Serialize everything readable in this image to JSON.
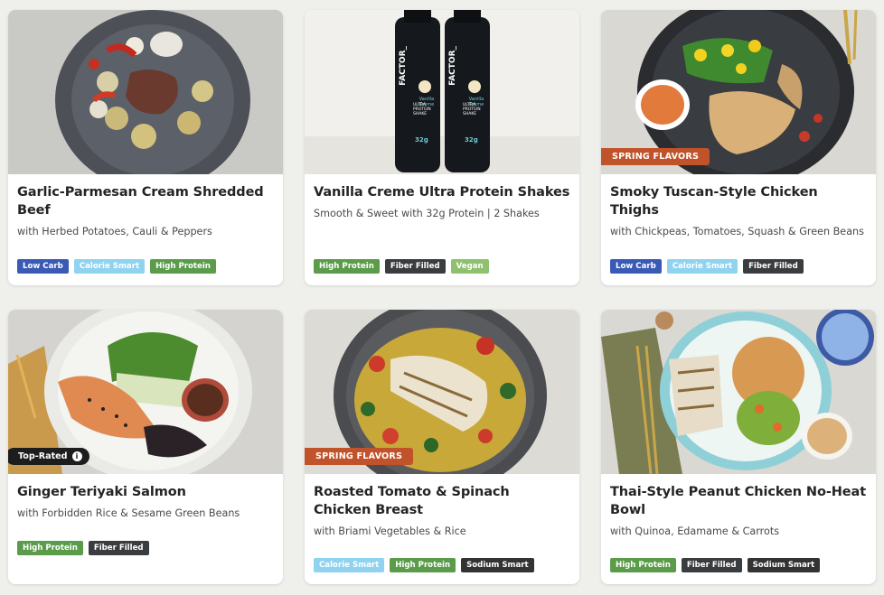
{
  "colors": {
    "background": "#efefec",
    "promo_badge": "#c0532a",
    "tag_low_carb": "#3a5ab8",
    "tag_calorie_smart": "#8fd3f0",
    "tag_high_protein": "#5a9c4a",
    "tag_fiber_filled": "#3a3d40",
    "tag_vegan": "#8fc06e",
    "tag_sodium_smart": "#333333"
  },
  "meals": [
    {
      "title": "Garlic-Parmesan Cream Shredded Beef",
      "subtitle": "with Herbed Potatoes, Cauli & Peppers",
      "badge": "",
      "tags": [
        "Low Carb",
        "Calorie Smart",
        "High Protein"
      ]
    },
    {
      "title": "Vanilla Creme Ultra Protein Shakes",
      "subtitle": "Smooth & Sweet with 32g Protein | 2 Shakes",
      "badge": "",
      "bottle_text": [
        "FACTOR_",
        "Vanilla Crème",
        "ULTRA PROTEIN SHAKE",
        "32g"
      ],
      "tags": [
        "High Protein",
        "Fiber Filled",
        "Vegan"
      ]
    },
    {
      "title": "Smoky Tuscan-Style Chicken Thighs",
      "subtitle": "with Chickpeas, Tomatoes, Squash & Green Beans",
      "badge": "SPRING FLAVORS",
      "tags": [
        "Low Carb",
        "Calorie Smart",
        "Fiber Filled"
      ]
    },
    {
      "title": "Ginger Teriyaki Salmon",
      "subtitle": "with Forbidden Rice & Sesame Green Beans",
      "badge": "Top-Rated",
      "tags": [
        "High Protein",
        "Fiber Filled"
      ]
    },
    {
      "title": "Roasted Tomato & Spinach Chicken Breast",
      "subtitle": "with Briami Vegetables & Rice",
      "badge": "SPRING FLAVORS",
      "tags": [
        "Calorie Smart",
        "High Protein",
        "Sodium Smart"
      ]
    },
    {
      "title": "Thai-Style Peanut Chicken No-Heat Bowl",
      "subtitle": "with Quinoa, Edamame & Carrots",
      "badge": "",
      "tags": [
        "High Protein",
        "Fiber Filled",
        "Sodium Smart"
      ]
    }
  ]
}
